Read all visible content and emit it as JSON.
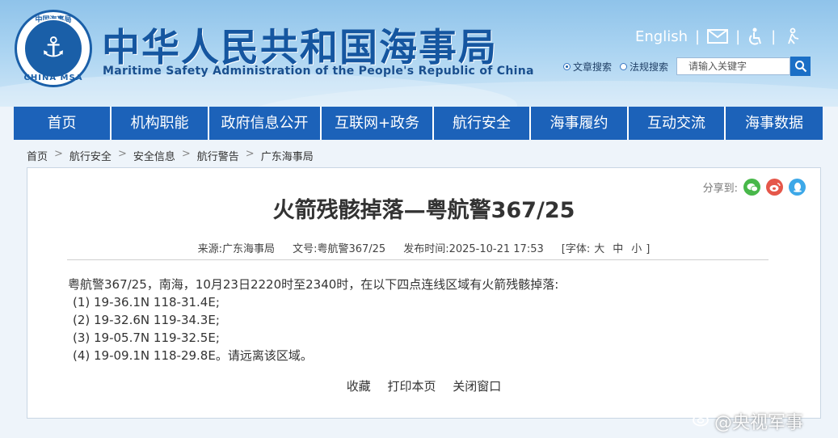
{
  "header": {
    "logo_top_text": "中国海事局",
    "logo_bottom_text": "CHINA MSA",
    "site_title": "中华人民共和国海事局",
    "site_subtitle": "Maritime Safety Administration of the People's Republic of China",
    "english_link": "English",
    "sep": "|",
    "icons": [
      "mail-icon",
      "accessibility-icon",
      "elder-mode-icon"
    ],
    "search": {
      "radio_article": "文章搜索",
      "radio_law": "法规搜索",
      "selected": "文章搜索",
      "placeholder": "请输入关键字"
    }
  },
  "nav": {
    "items": [
      {
        "label": "首页",
        "width": 121
      },
      {
        "label": "机构职能",
        "width": 121
      },
      {
        "label": "政府信息公开",
        "width": 139
      },
      {
        "label": "互联网+政务",
        "width": 139
      },
      {
        "label": "航行安全",
        "width": 120
      },
      {
        "label": "海事履约",
        "width": 121
      },
      {
        "label": "互动交流",
        "width": 120
      },
      {
        "label": "海事数据",
        "width": 120
      }
    ]
  },
  "breadcrumb": [
    "首页",
    "航行安全",
    "安全信息",
    "航行警告",
    "广东海事局"
  ],
  "article": {
    "share_label": "分享到:",
    "share_icons": [
      "wechat-icon",
      "weibo-icon",
      "qq-icon"
    ],
    "title": "火箭残骸掉落—粤航警367/25",
    "source_label": "来源:",
    "source": "广东海事局",
    "docno_label": "文号:",
    "docno": "粤航警367/25",
    "date_label": "发布时间:",
    "date": "2025-10-21 17:53",
    "font_label": "[字体:",
    "font_large": "大",
    "font_medium": "中",
    "font_small": "小",
    "font_close": "]",
    "lead": "粤航警367/25，南海，10月23日2220时至2340时，在以下四点连线区域有火箭残骸掉落:",
    "points": [
      "(1)  19-36.1N  118-31.4E;",
      "(2)  19-32.6N  119-34.3E;",
      "(3)  19-05.7N  119-32.5E;",
      "(4)  19-09.1N  118-29.8E。请远离该区域。"
    ],
    "actions": {
      "favorite": "收藏",
      "print": "打印本页",
      "close": "关闭窗口"
    }
  },
  "watermark": "@央视军事",
  "colors": {
    "nav_bg": "#1c62b9",
    "title_blue": "#1556a0",
    "wechat": "#48b84a",
    "weibo": "#e5574a",
    "qq": "#3da8e8"
  }
}
